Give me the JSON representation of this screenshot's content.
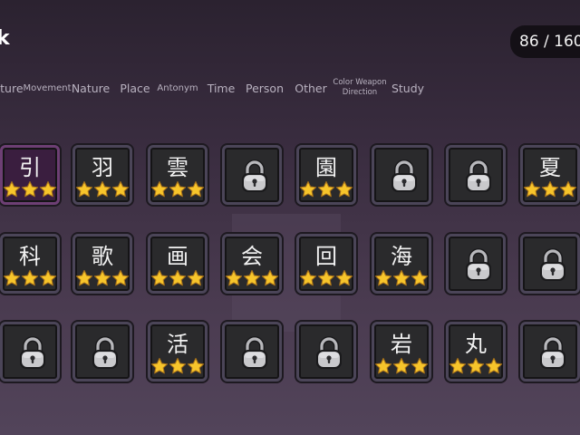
{
  "header": {
    "title": "k",
    "counter": "86 / 160"
  },
  "tabs": [
    {
      "id": "nature-partial",
      "label": "ature",
      "size": "md"
    },
    {
      "id": "movement",
      "label": "Movement",
      "size": "sm"
    },
    {
      "id": "nature",
      "label": "Nature",
      "size": "md"
    },
    {
      "id": "place",
      "label": "Place",
      "size": "md"
    },
    {
      "id": "antonym",
      "label": "Antonym",
      "size": "sm"
    },
    {
      "id": "time",
      "label": "Time",
      "size": "md"
    },
    {
      "id": "person",
      "label": "Person",
      "size": "md"
    },
    {
      "id": "other",
      "label": "Other",
      "size": "md"
    },
    {
      "id": "color-weapon-direction",
      "label": "Color Weapon",
      "label2": "Direction",
      "size": "two"
    },
    {
      "id": "study",
      "label": "Study",
      "size": "md"
    }
  ],
  "colors": {
    "star_fill": "#f7c52b",
    "star_stroke": "#a9731a",
    "card_bg": "#2a2a2c",
    "card_border": "#4b4558",
    "selected_bg": "#3a1e3f",
    "lock_body": "#c9c9cc"
  },
  "cards": [
    [
      {
        "kanji": "引",
        "stars": 3,
        "locked": false,
        "selected": true
      },
      {
        "kanji": "羽",
        "stars": 3,
        "locked": false
      },
      {
        "kanji": "雲",
        "stars": 3,
        "locked": false
      },
      {
        "kanji": "",
        "locked": true
      },
      {
        "kanji": "園",
        "stars": 3,
        "locked": false
      },
      {
        "kanji": "",
        "locked": true
      },
      {
        "kanji": "",
        "locked": true
      },
      {
        "kanji": "夏",
        "stars": 3,
        "locked": false
      }
    ],
    [
      {
        "kanji": "科",
        "stars": 3,
        "locked": false
      },
      {
        "kanji": "歌",
        "stars": 3,
        "locked": false
      },
      {
        "kanji": "画",
        "stars": 3,
        "locked": false
      },
      {
        "kanji": "会",
        "stars": 3,
        "locked": false
      },
      {
        "kanji": "回",
        "stars": 3,
        "locked": false
      },
      {
        "kanji": "海",
        "stars": 3,
        "locked": false
      },
      {
        "kanji": "",
        "locked": true
      },
      {
        "kanji": "",
        "locked": true
      }
    ],
    [
      {
        "kanji": "",
        "locked": true
      },
      {
        "kanji": "",
        "locked": true
      },
      {
        "kanji": "活",
        "stars": 3,
        "locked": false
      },
      {
        "kanji": "",
        "locked": true
      },
      {
        "kanji": "",
        "locked": true
      },
      {
        "kanji": "岩",
        "stars": 3,
        "locked": false
      },
      {
        "kanji": "丸",
        "stars": 3,
        "locked": false
      },
      {
        "kanji": "",
        "locked": true
      }
    ]
  ]
}
